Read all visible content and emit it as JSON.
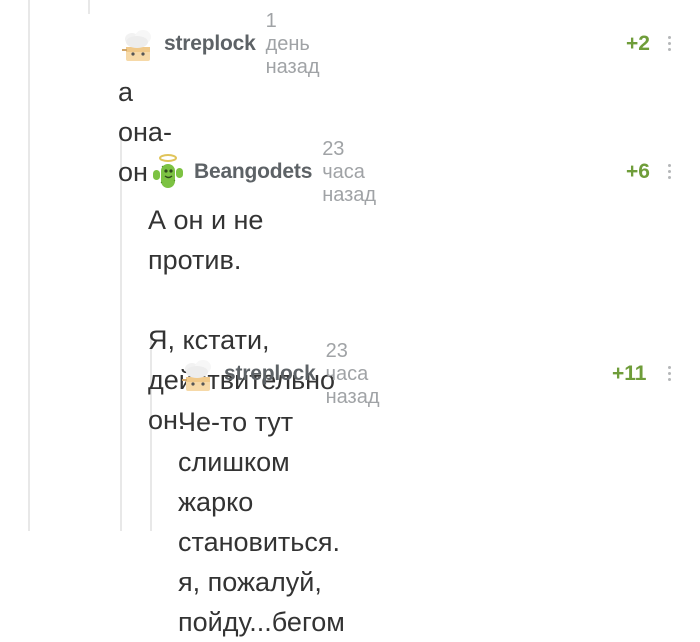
{
  "comments": [
    {
      "author": "streplock",
      "time": "1 день назад",
      "rating": "+2",
      "lines": [
        "а она-он"
      ],
      "avatar_icon": "chef-cube-avatar-icon"
    },
    {
      "author": "Beangodets",
      "time": "23 часа назад",
      "rating": "+6",
      "lines": [
        "А он и не против.",
        "",
        "Я, кстати, действительно он."
      ],
      "avatar_icon": "angel-cactus-avatar-icon"
    },
    {
      "author": "streplock",
      "time": "23 часа назад",
      "rating": "+11",
      "lines": [
        "Че-то тут слишком жарко",
        "становиться. я, пожалуй,",
        "пойду...бегом"
      ],
      "avatar_icon": "chef-cube-avatar-icon"
    }
  ],
  "colors": {
    "author": "#5d6266",
    "time": "#a0a3a6",
    "rating": "#6f9d3a",
    "text": "#333333",
    "thread_line": "#e8e8e8"
  }
}
